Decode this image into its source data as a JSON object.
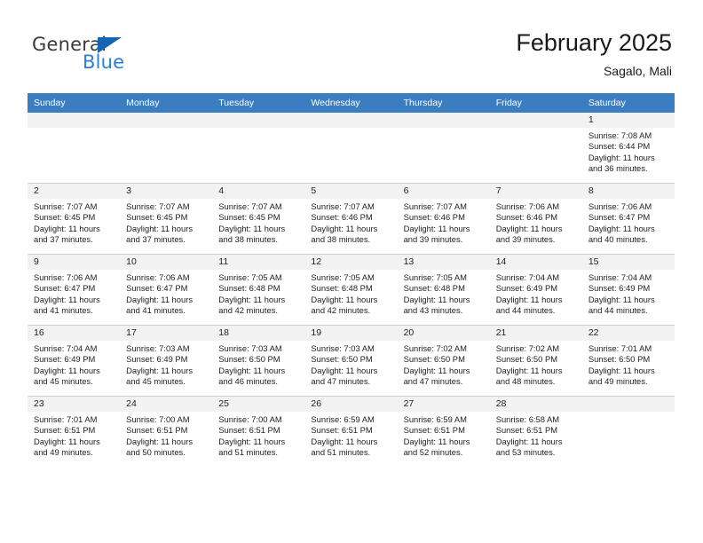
{
  "brand": {
    "name_part1": "General",
    "name_part2": "Blue",
    "accent_color": "#2a7fd4",
    "triangle_color": "#1565b0"
  },
  "header": {
    "title": "February 2025",
    "subtitle": "Sagalo, Mali"
  },
  "calendar": {
    "header_bg": "#3a7dc0",
    "weekdays": [
      "Sunday",
      "Monday",
      "Tuesday",
      "Wednesday",
      "Thursday",
      "Friday",
      "Saturday"
    ],
    "labels": {
      "sunrise": "Sunrise:",
      "sunset": "Sunset:",
      "daylight": "Daylight:"
    },
    "weeks": [
      [
        {
          "day": "",
          "sunrise": "",
          "sunset": "",
          "daylight": ""
        },
        {
          "day": "",
          "sunrise": "",
          "sunset": "",
          "daylight": ""
        },
        {
          "day": "",
          "sunrise": "",
          "sunset": "",
          "daylight": ""
        },
        {
          "day": "",
          "sunrise": "",
          "sunset": "",
          "daylight": ""
        },
        {
          "day": "",
          "sunrise": "",
          "sunset": "",
          "daylight": ""
        },
        {
          "day": "",
          "sunrise": "",
          "sunset": "",
          "daylight": ""
        },
        {
          "day": "1",
          "sunrise": "Sunrise: 7:08 AM",
          "sunset": "Sunset: 6:44 PM",
          "daylight": "Daylight: 11 hours and 36 minutes."
        }
      ],
      [
        {
          "day": "2",
          "sunrise": "Sunrise: 7:07 AM",
          "sunset": "Sunset: 6:45 PM",
          "daylight": "Daylight: 11 hours and 37 minutes."
        },
        {
          "day": "3",
          "sunrise": "Sunrise: 7:07 AM",
          "sunset": "Sunset: 6:45 PM",
          "daylight": "Daylight: 11 hours and 37 minutes."
        },
        {
          "day": "4",
          "sunrise": "Sunrise: 7:07 AM",
          "sunset": "Sunset: 6:45 PM",
          "daylight": "Daylight: 11 hours and 38 minutes."
        },
        {
          "day": "5",
          "sunrise": "Sunrise: 7:07 AM",
          "sunset": "Sunset: 6:46 PM",
          "daylight": "Daylight: 11 hours and 38 minutes."
        },
        {
          "day": "6",
          "sunrise": "Sunrise: 7:07 AM",
          "sunset": "Sunset: 6:46 PM",
          "daylight": "Daylight: 11 hours and 39 minutes."
        },
        {
          "day": "7",
          "sunrise": "Sunrise: 7:06 AM",
          "sunset": "Sunset: 6:46 PM",
          "daylight": "Daylight: 11 hours and 39 minutes."
        },
        {
          "day": "8",
          "sunrise": "Sunrise: 7:06 AM",
          "sunset": "Sunset: 6:47 PM",
          "daylight": "Daylight: 11 hours and 40 minutes."
        }
      ],
      [
        {
          "day": "9",
          "sunrise": "Sunrise: 7:06 AM",
          "sunset": "Sunset: 6:47 PM",
          "daylight": "Daylight: 11 hours and 41 minutes."
        },
        {
          "day": "10",
          "sunrise": "Sunrise: 7:06 AM",
          "sunset": "Sunset: 6:47 PM",
          "daylight": "Daylight: 11 hours and 41 minutes."
        },
        {
          "day": "11",
          "sunrise": "Sunrise: 7:05 AM",
          "sunset": "Sunset: 6:48 PM",
          "daylight": "Daylight: 11 hours and 42 minutes."
        },
        {
          "day": "12",
          "sunrise": "Sunrise: 7:05 AM",
          "sunset": "Sunset: 6:48 PM",
          "daylight": "Daylight: 11 hours and 42 minutes."
        },
        {
          "day": "13",
          "sunrise": "Sunrise: 7:05 AM",
          "sunset": "Sunset: 6:48 PM",
          "daylight": "Daylight: 11 hours and 43 minutes."
        },
        {
          "day": "14",
          "sunrise": "Sunrise: 7:04 AM",
          "sunset": "Sunset: 6:49 PM",
          "daylight": "Daylight: 11 hours and 44 minutes."
        },
        {
          "day": "15",
          "sunrise": "Sunrise: 7:04 AM",
          "sunset": "Sunset: 6:49 PM",
          "daylight": "Daylight: 11 hours and 44 minutes."
        }
      ],
      [
        {
          "day": "16",
          "sunrise": "Sunrise: 7:04 AM",
          "sunset": "Sunset: 6:49 PM",
          "daylight": "Daylight: 11 hours and 45 minutes."
        },
        {
          "day": "17",
          "sunrise": "Sunrise: 7:03 AM",
          "sunset": "Sunset: 6:49 PM",
          "daylight": "Daylight: 11 hours and 45 minutes."
        },
        {
          "day": "18",
          "sunrise": "Sunrise: 7:03 AM",
          "sunset": "Sunset: 6:50 PM",
          "daylight": "Daylight: 11 hours and 46 minutes."
        },
        {
          "day": "19",
          "sunrise": "Sunrise: 7:03 AM",
          "sunset": "Sunset: 6:50 PM",
          "daylight": "Daylight: 11 hours and 47 minutes."
        },
        {
          "day": "20",
          "sunrise": "Sunrise: 7:02 AM",
          "sunset": "Sunset: 6:50 PM",
          "daylight": "Daylight: 11 hours and 47 minutes."
        },
        {
          "day": "21",
          "sunrise": "Sunrise: 7:02 AM",
          "sunset": "Sunset: 6:50 PM",
          "daylight": "Daylight: 11 hours and 48 minutes."
        },
        {
          "day": "22",
          "sunrise": "Sunrise: 7:01 AM",
          "sunset": "Sunset: 6:50 PM",
          "daylight": "Daylight: 11 hours and 49 minutes."
        }
      ],
      [
        {
          "day": "23",
          "sunrise": "Sunrise: 7:01 AM",
          "sunset": "Sunset: 6:51 PM",
          "daylight": "Daylight: 11 hours and 49 minutes."
        },
        {
          "day": "24",
          "sunrise": "Sunrise: 7:00 AM",
          "sunset": "Sunset: 6:51 PM",
          "daylight": "Daylight: 11 hours and 50 minutes."
        },
        {
          "day": "25",
          "sunrise": "Sunrise: 7:00 AM",
          "sunset": "Sunset: 6:51 PM",
          "daylight": "Daylight: 11 hours and 51 minutes."
        },
        {
          "day": "26",
          "sunrise": "Sunrise: 6:59 AM",
          "sunset": "Sunset: 6:51 PM",
          "daylight": "Daylight: 11 hours and 51 minutes."
        },
        {
          "day": "27",
          "sunrise": "Sunrise: 6:59 AM",
          "sunset": "Sunset: 6:51 PM",
          "daylight": "Daylight: 11 hours and 52 minutes."
        },
        {
          "day": "28",
          "sunrise": "Sunrise: 6:58 AM",
          "sunset": "Sunset: 6:51 PM",
          "daylight": "Daylight: 11 hours and 53 minutes."
        },
        {
          "day": "",
          "sunrise": "",
          "sunset": "",
          "daylight": ""
        }
      ]
    ]
  }
}
